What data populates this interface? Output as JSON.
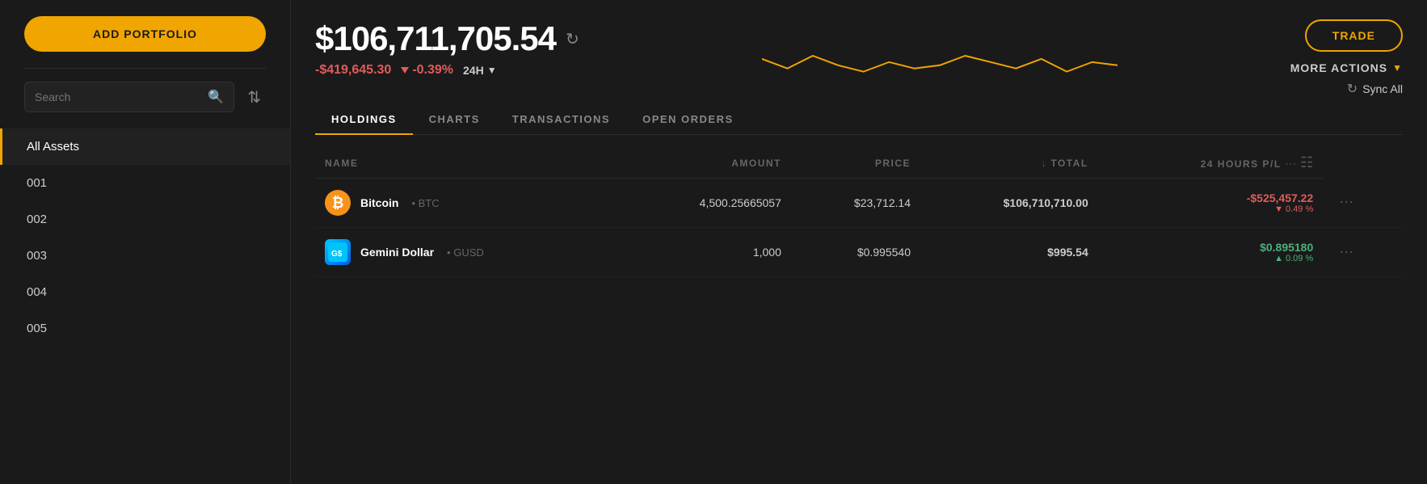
{
  "sidebar": {
    "add_portfolio_label": "ADD PORTFOLIO",
    "search_placeholder": "Search",
    "nav_items": [
      {
        "id": "all-assets",
        "label": "All Assets",
        "active": true
      },
      {
        "id": "001",
        "label": "001"
      },
      {
        "id": "002",
        "label": "002"
      },
      {
        "id": "003",
        "label": "003"
      },
      {
        "id": "004",
        "label": "004"
      },
      {
        "id": "005",
        "label": "005"
      }
    ]
  },
  "portfolio": {
    "value": "$106,711,705.54",
    "change_amount": "-$419,645.30",
    "change_pct": "-0.39%",
    "period": "24H"
  },
  "actions": {
    "trade_label": "TRADE",
    "more_actions_label": "MORE ACTIONS",
    "sync_all_label": "Sync All"
  },
  "tabs": [
    {
      "id": "holdings",
      "label": "HOLDINGS",
      "active": true
    },
    {
      "id": "charts",
      "label": "CHARTS",
      "active": false
    },
    {
      "id": "transactions",
      "label": "TRANSACTIONS",
      "active": false
    },
    {
      "id": "open-orders",
      "label": "OPEN ORDERS",
      "active": false
    }
  ],
  "table": {
    "columns": {
      "name": "NAME",
      "amount": "AMOUNT",
      "price": "PRICE",
      "total": "TOTAL",
      "pnl": "24 HOURS P/L"
    },
    "rows": [
      {
        "id": "btc",
        "icon_type": "btc",
        "name": "Bitcoin",
        "ticker": "BTC",
        "amount": "4,500.25665057",
        "price": "$23,712.14",
        "total": "$106,710,710.00",
        "pnl_amount": "-$525,457.22",
        "pnl_pct": "▼ 0.49 %",
        "pnl_positive": false
      },
      {
        "id": "gusd",
        "icon_type": "gusd",
        "name": "Gemini Dollar",
        "ticker": "GUSD",
        "amount": "1,000",
        "price": "$0.995540",
        "total": "$995.54",
        "pnl_amount": "$0.895180",
        "pnl_pct": "▲ 0.09 %",
        "pnl_positive": true
      }
    ]
  },
  "chart": {
    "points": [
      [
        0,
        40
      ],
      [
        40,
        55
      ],
      [
        80,
        35
      ],
      [
        120,
        50
      ],
      [
        160,
        60
      ],
      [
        200,
        45
      ],
      [
        240,
        55
      ],
      [
        280,
        50
      ],
      [
        320,
        35
      ],
      [
        360,
        45
      ],
      [
        400,
        55
      ],
      [
        440,
        40
      ],
      [
        480,
        60
      ],
      [
        520,
        45
      ],
      [
        560,
        50
      ]
    ],
    "color": "#f0a500"
  }
}
